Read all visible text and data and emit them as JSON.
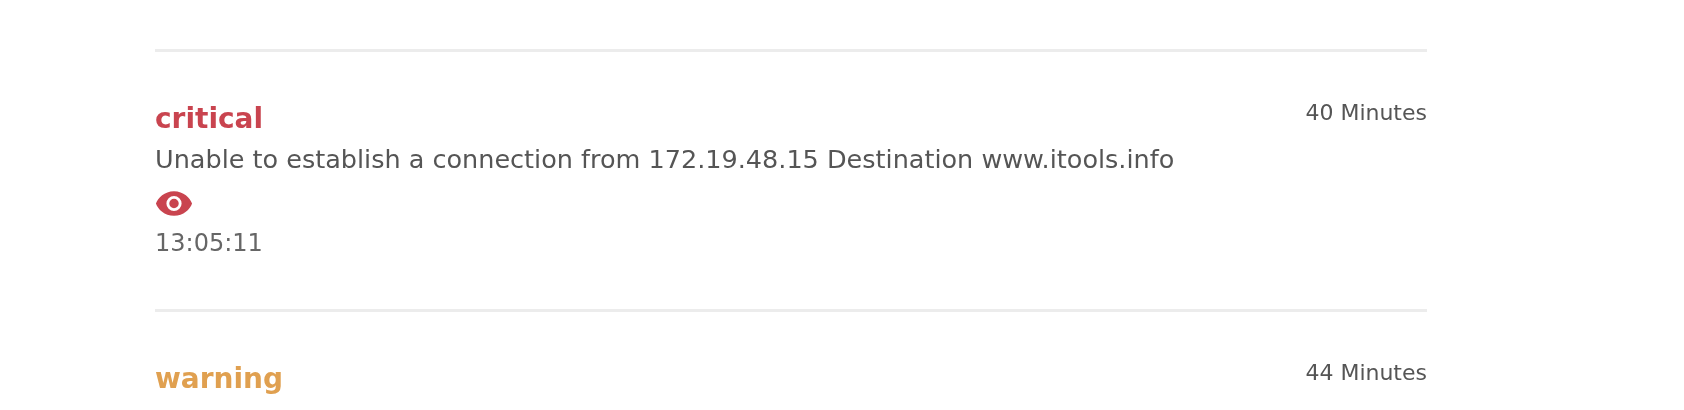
{
  "alerts": [
    {
      "severity": "critical",
      "age": "40 Minutes",
      "message": "Unable to establish a connection from 172.19.48.15 Destination www.itools.info",
      "time": "13:05:11"
    },
    {
      "severity": "warning",
      "age": "44 Minutes"
    }
  ]
}
